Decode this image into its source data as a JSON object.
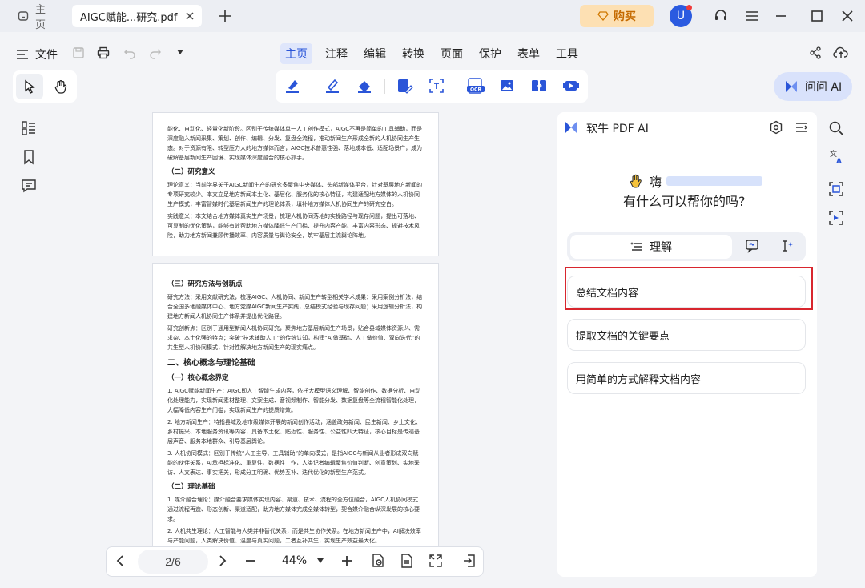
{
  "titlebar": {
    "home_tab": "主页",
    "doc_tab": "AIGC赋能...研究.pdf",
    "buy": "购买",
    "avatar_letter": "U"
  },
  "menubar": {
    "file": "文件",
    "items": [
      "主页",
      "注释",
      "编辑",
      "转换",
      "页面",
      "保护",
      "表单",
      "工具"
    ],
    "active": "主页"
  },
  "ai_button": "问问 AI",
  "document": {
    "page1": {
      "intro": "能化、自动化、轻量化新阶段。区别于传统媒体单一人工创作模式，AIGC不再是简单的工具辅助，而是深度融入新闻采集、策划、创作、编辑、分发、复盘全流程，推动新闻生产形成全新的人机协同生产生态。对于资源有限、转型压力大的地方媒体而言，AIGC技术普惠性强、落地成本低、适配场景广，成为破解基层新闻生产困境、实现媒体深度融合的核心抓手。",
      "h_significance": "（二）研究意义",
      "theory": "理论意义：当前学界关于AIGC新闻生产的研究多聚焦中央媒体、头部新媒体平台，针对基层地方新闻的专项研究较少。本文立足地方新闻本土化、基层化、服务化的核心特征，构建适配地方媒体的人机协同生产模式，丰富智媒时代基层新闻生产的理论体系，填补地方媒体人机协同生产的研究空白。",
      "practice": "实践意义：本文结合地方媒体真实生产场景，梳理人机协同落地的实操路径与现存问题，提出可落地、可复制的优化策略，能够有效帮助地方媒体降低生产门槛、提升内容产能、丰富内容形态、规避技术风险，助力地方新闻兼顾传播效率、内容质量与舆论安全，筑牢基层主流舆论阵地。"
    },
    "page2": {
      "h_method": "（三）研究方法与创新点",
      "method": "研究方法：采用文献研究法，梳理AIGC、人机协同、新闻生产转型相关学术成果；采用案例分析法，结合全国多地融媒体中心、地方党媒AIGC新闻生产实践，总结模式经验与现存问题；采用逻辑分析法，构建地方新闻人机协同生产体系并提出优化路径。",
      "innovation": "研究创新点：区别于通用型新闻人机协同研究，聚焦地方基层新闻生产场景，贴合县域媒体资源少、需求杂、本土化强的特点；突破“技术辅助人工”的传统认知，构建“AI做基础、人工做价值、双向迭代”的共生型人机协同模式，针对性解决地方新闻生产的现实痛点。",
      "h2": "二、核心概念与理论基础",
      "h_concept": "（一）核心概念界定",
      "c1": "1. AIGC赋能新闻生产：AIGC即人工智能生成内容，依托大模型语义理解、智能创作、数据分析、自动化处理能力，实现新闻素材整理、文案生成、音视频制作、智能分发、数据复盘等全流程智能化处理，大幅降低内容生产门槛，实现新闻生产的提质增效。",
      "c2": "2. 地方新闻生产：特指县域及地市级媒体开展的新闻创作活动，涵盖政务新闻、民生新闻、乡土文化、乡村振兴、本地服务资讯等内容，具备本土化、贴近性、服务性、公益性四大特征，核心目标是传递基层声音、服务本地群众、引导基层舆论。",
      "c3": "3. 人机协同模式：区别于传统“人工主导、工具辅助”的单向模式，是指AIGC与新闻从业者形成双向赋能的伙伴关系，AI承担标准化、重复性、数据性工作，人类记者编辑聚焦价值判断、创意策划、实地采访、人文表达、事实把关，形成分工明确、优势互补、迭代优化的新型生产范式。",
      "h_theory": "（二）理论基础",
      "t1": "1. 媒介融合理论：媒介融合要求媒体实现内容、渠道、技术、流程的全方位融合，AIGC人机协同模式通过流程再造、形态创新、渠道适配，助力地方媒体完成全媒体转型，契合媒介融合纵深发展的核心要求。",
      "t2": "2. 人机共生理论：人工智能与人类并非替代关系，而是共生协作关系。在地方新闻生产中，AI解决效率与产能问题，人类解决价值、温度与真实问题，二者互补共生，实现生产效益最大化。"
    }
  },
  "pagenav": {
    "page": "2/6",
    "zoom": "44%"
  },
  "ai_panel": {
    "title": "软牛 PDF AI",
    "greeting": "嗨",
    "question": "有什么可以帮你的吗?",
    "tab_understand": "理解",
    "suggestions": [
      "总结文档内容",
      "提取文档的关键要点",
      "用简单的方式解释文档内容"
    ]
  },
  "colors": {
    "accent": "#2a55d8",
    "highlight_border": "#d8262e",
    "buy_bg": "#fde0b3"
  }
}
